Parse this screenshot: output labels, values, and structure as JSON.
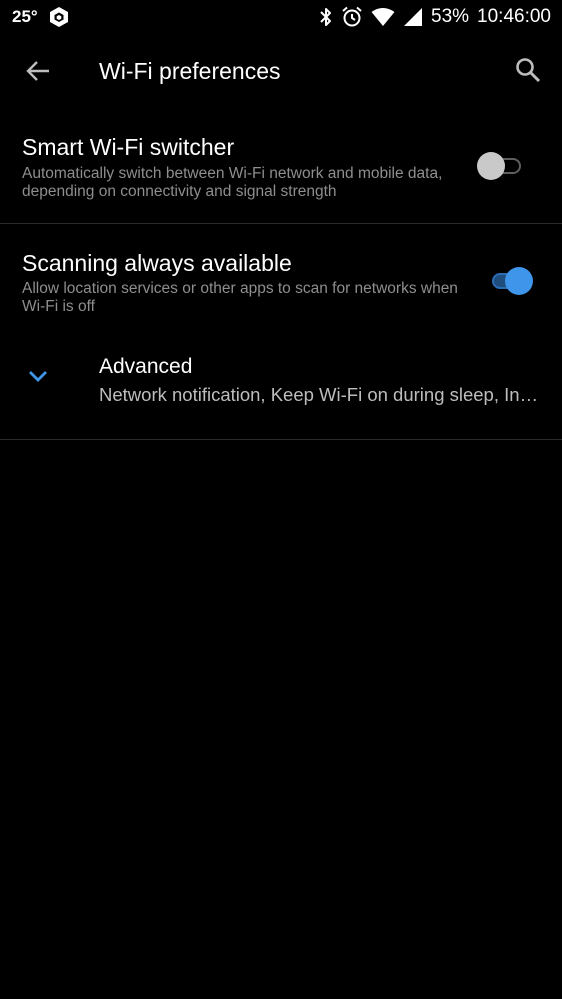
{
  "status_bar": {
    "temperature": "25°",
    "battery": "53%",
    "time": "10:46:00",
    "icons": [
      "app-notification-icon",
      "bluetooth-icon",
      "alarm-icon",
      "wifi-icon",
      "cell-signal-icon"
    ]
  },
  "app_bar": {
    "title": "Wi-Fi preferences",
    "back_icon": "arrow-back-icon",
    "search_icon": "search-icon"
  },
  "settings": {
    "smart_switcher": {
      "title": "Smart Wi-Fi switcher",
      "summary": "Automatically switch between Wi-Fi network and mobile data, depending on connectivity and signal strength",
      "enabled": false
    },
    "scanning": {
      "title": "Scanning always available",
      "summary": "Allow location services or other apps to scan for networks when Wi-Fi is off",
      "enabled": true
    },
    "advanced": {
      "title": "Advanced",
      "summary": "Network notification, Keep Wi-Fi on during sleep, Install certificates, Wi-Fi Direct",
      "icon": "chevron-down-icon"
    }
  },
  "colors": {
    "background": "#000000",
    "accent": "#3f95ea",
    "summary_text": "#8e8e8e",
    "divider": "#2a2a2a"
  }
}
